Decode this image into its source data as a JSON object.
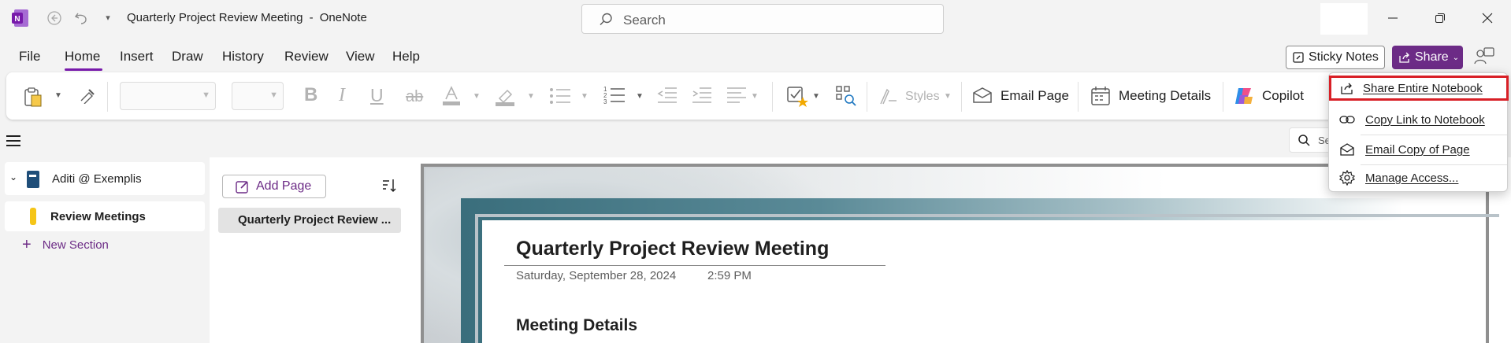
{
  "app": {
    "window_title": "Quarterly Project Review Meeting",
    "title_separator": "-",
    "app_name": "OneNote",
    "search_placeholder": "Search"
  },
  "menu": {
    "tabs": [
      "File",
      "Home",
      "Insert",
      "Draw",
      "History",
      "Review",
      "View",
      "Help"
    ],
    "active_tab": "Home",
    "sticky_notes_label": "Sticky Notes",
    "share_label": "Share"
  },
  "ribbon": {
    "styles_label": "Styles",
    "email_page_label": "Email Page",
    "meeting_details_label": "Meeting Details",
    "copilot_label": "Copilot"
  },
  "notebook": {
    "name": "Aditi @ Exemplis",
    "section": "Review Meetings",
    "new_section_label": "New Section",
    "section_color": "#f5c518"
  },
  "pages": {
    "add_page_label": "Add Page",
    "items": [
      "Quarterly Project Review ..."
    ]
  },
  "page": {
    "title": "Quarterly Project Review Meeting",
    "date": "Saturday, September 28, 2024",
    "time": "2:59 PM",
    "heading": "Meeting Details"
  },
  "right_search": {
    "partial_text": "Se"
  },
  "share_menu": {
    "items": [
      {
        "label": "Share Entire Notebook",
        "icon": "share-notebook-icon",
        "highlighted": true
      },
      {
        "label": "Copy Link to Notebook",
        "icon": "link-icon"
      },
      {
        "label": "Email Copy of Page",
        "icon": "email-icon"
      },
      {
        "label": "Manage Access...",
        "icon": "gear-icon"
      }
    ]
  },
  "colors": {
    "accent": "#7719aa",
    "share_button": "#6c2b86",
    "highlight_border": "#d81f26",
    "onenote_brand": "#7719aa"
  }
}
